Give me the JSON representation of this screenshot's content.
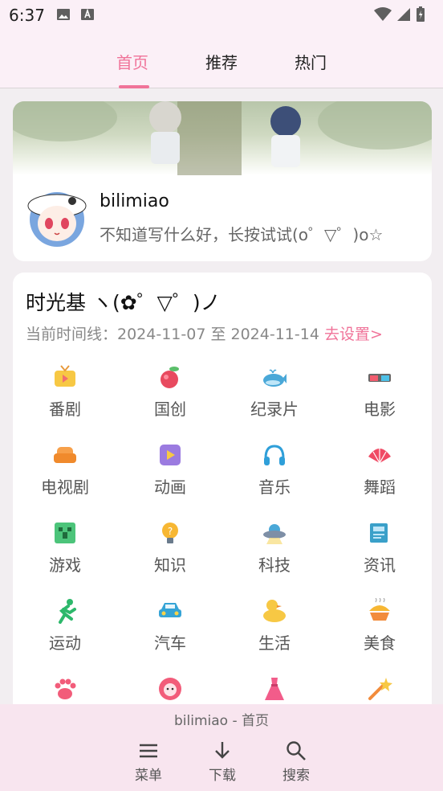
{
  "status_bar": {
    "time": "6:37"
  },
  "tabs": [
    {
      "label": "首页",
      "active": true
    },
    {
      "label": "推荐",
      "active": false
    },
    {
      "label": "热门",
      "active": false
    }
  ],
  "profile": {
    "name": "bilimiao",
    "signature": "不知道写什么好，长按试试(o゜▽゜)o☆"
  },
  "time_machine": {
    "title": "时光基 ヽ(✿゜▽゜)ノ",
    "timeline_text": "当前时间线：2024-11-07 至 2024-11-14",
    "set_link": "去设置>"
  },
  "categories": [
    {
      "label": "番剧",
      "icon": "tv-icon"
    },
    {
      "label": "国创",
      "icon": "peach-icon"
    },
    {
      "label": "纪录片",
      "icon": "whale-icon"
    },
    {
      "label": "电影",
      "icon": "3d-glasses-icon"
    },
    {
      "label": "电视剧",
      "icon": "sofa-icon"
    },
    {
      "label": "动画",
      "icon": "play-icon"
    },
    {
      "label": "音乐",
      "icon": "headphones-icon"
    },
    {
      "label": "舞蹈",
      "icon": "fan-icon"
    },
    {
      "label": "游戏",
      "icon": "creeper-icon"
    },
    {
      "label": "知识",
      "icon": "lightbulb-icon"
    },
    {
      "label": "科技",
      "icon": "ufo-icon"
    },
    {
      "label": "资讯",
      "icon": "newspaper-icon"
    },
    {
      "label": "运动",
      "icon": "runner-icon"
    },
    {
      "label": "汽车",
      "icon": "car-icon"
    },
    {
      "label": "生活",
      "icon": "duck-icon"
    },
    {
      "label": "美食",
      "icon": "food-icon"
    },
    {
      "label": "",
      "icon": "paw-icon"
    },
    {
      "label": "",
      "icon": "sheep-icon"
    },
    {
      "label": "",
      "icon": "dress-icon"
    },
    {
      "label": "",
      "icon": "magic-wand-icon"
    }
  ],
  "bottom_sheet": {
    "title": "bilimiao - 首页",
    "buttons": [
      {
        "label": "菜单",
        "icon": "menu-icon"
      },
      {
        "label": "下载",
        "icon": "download-icon"
      },
      {
        "label": "搜索",
        "icon": "search-icon"
      }
    ]
  },
  "colors": {
    "accent": "#f07399",
    "background": "#f2eef1",
    "top_bar": "#fbf0f7"
  }
}
